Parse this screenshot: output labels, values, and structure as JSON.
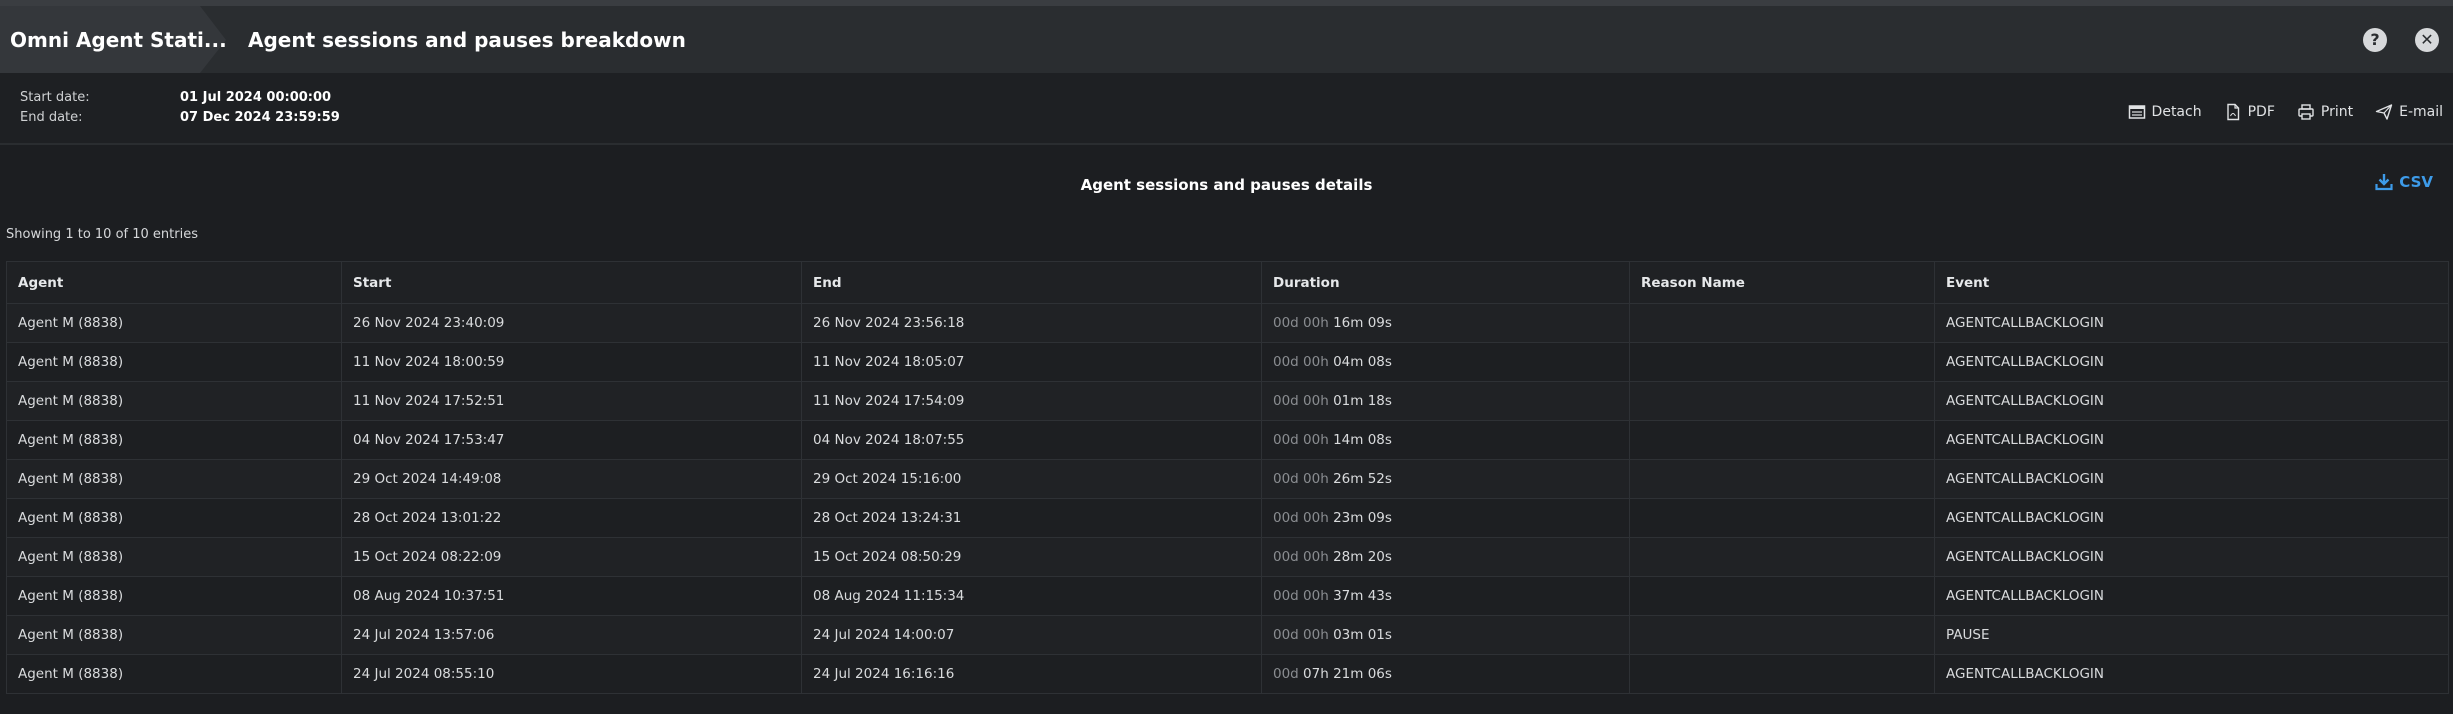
{
  "header": {
    "app_title": "Omni Agent Stati...",
    "page_title": "Agent sessions and pauses breakdown"
  },
  "info": {
    "start_label": "Start date:",
    "start_value": "01 Jul 2024 00:00:00",
    "end_label": "End date:",
    "end_value": "07 Dec 2024 23:59:59"
  },
  "actions": {
    "detach": "Detach",
    "pdf": "PDF",
    "print": "Print",
    "email": "E-mail"
  },
  "section": {
    "title": "Agent sessions and pauses details",
    "csv": "CSV",
    "entries": "Showing 1 to 10 of 10 entries"
  },
  "table": {
    "headers": [
      "Agent",
      "Start",
      "End",
      "Duration",
      "Reason Name",
      "Event"
    ],
    "rows": [
      {
        "agent": "Agent M (8838)",
        "start": "26 Nov 2024 23:40:09",
        "end": "26 Nov 2024 23:56:18",
        "dur_prefix": "00d 00h",
        "dur_main": "16m 09s",
        "reason": "",
        "event": "AGENTCALLBACKLOGIN"
      },
      {
        "agent": "Agent M (8838)",
        "start": "11 Nov 2024 18:00:59",
        "end": "11 Nov 2024 18:05:07",
        "dur_prefix": "00d 00h",
        "dur_main": "04m 08s",
        "reason": "",
        "event": "AGENTCALLBACKLOGIN"
      },
      {
        "agent": "Agent M (8838)",
        "start": "11 Nov 2024 17:52:51",
        "end": "11 Nov 2024 17:54:09",
        "dur_prefix": "00d 00h",
        "dur_main": "01m 18s",
        "reason": "",
        "event": "AGENTCALLBACKLOGIN"
      },
      {
        "agent": "Agent M (8838)",
        "start": "04 Nov 2024 17:53:47",
        "end": "04 Nov 2024 18:07:55",
        "dur_prefix": "00d 00h",
        "dur_main": "14m 08s",
        "reason": "",
        "event": "AGENTCALLBACKLOGIN"
      },
      {
        "agent": "Agent M (8838)",
        "start": "29 Oct 2024 14:49:08",
        "end": "29 Oct 2024 15:16:00",
        "dur_prefix": "00d 00h",
        "dur_main": "26m 52s",
        "reason": "",
        "event": "AGENTCALLBACKLOGIN"
      },
      {
        "agent": "Agent M (8838)",
        "start": "28 Oct 2024 13:01:22",
        "end": "28 Oct 2024 13:24:31",
        "dur_prefix": "00d 00h",
        "dur_main": "23m 09s",
        "reason": "",
        "event": "AGENTCALLBACKLOGIN"
      },
      {
        "agent": "Agent M (8838)",
        "start": "15 Oct 2024 08:22:09",
        "end": "15 Oct 2024 08:50:29",
        "dur_prefix": "00d 00h",
        "dur_main": "28m 20s",
        "reason": "",
        "event": "AGENTCALLBACKLOGIN"
      },
      {
        "agent": "Agent M (8838)",
        "start": "08 Aug 2024 10:37:51",
        "end": "08 Aug 2024 11:15:34",
        "dur_prefix": "00d 00h",
        "dur_main": "37m 43s",
        "reason": "",
        "event": "AGENTCALLBACKLOGIN"
      },
      {
        "agent": "Agent M (8838)",
        "start": "24 Jul 2024 13:57:06",
        "end": "24 Jul 2024 14:00:07",
        "dur_prefix": "00d 00h",
        "dur_main": "03m 01s",
        "reason": "",
        "event": "PAUSE"
      },
      {
        "agent": "Agent M (8838)",
        "start": "24 Jul 2024 08:55:10",
        "end": "24 Jul 2024 16:16:16",
        "dur_prefix": "00d",
        "dur_main": "07h 21m 06s",
        "reason": "",
        "event": "AGENTCALLBACKLOGIN"
      }
    ]
  },
  "icons": {
    "help": "question-circle-icon",
    "close": "close-circle-icon",
    "detach": "detach-window-icon",
    "pdf": "pdf-file-icon",
    "print": "printer-icon",
    "email": "paper-plane-icon",
    "csv": "download-icon"
  },
  "colors": {
    "accent": "#3d9be9",
    "background": "#1c1e21",
    "titlebar": "#2a2d30"
  }
}
